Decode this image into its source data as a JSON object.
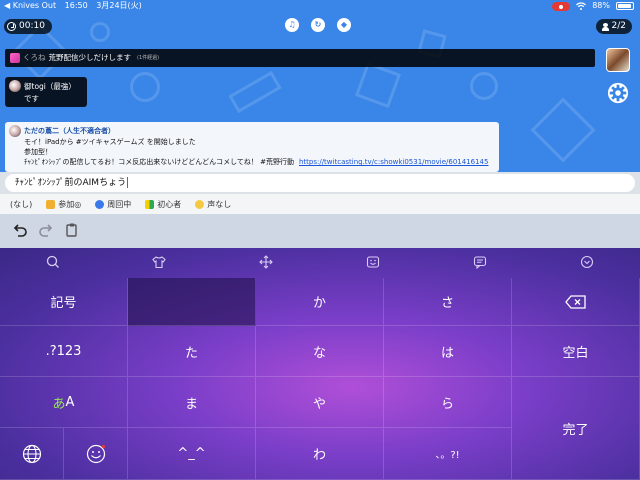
{
  "status_bar": {
    "back_app": "◀ Knives Out",
    "time": "16:50",
    "date": "3月24日(火)",
    "battery": "88%"
  },
  "stream": {
    "timer": "00:10",
    "viewers": "2/2",
    "top_icons": [
      "headset-icon",
      "refresh-icon",
      "drop-icon"
    ],
    "marquee": {
      "user": "くろね",
      "message": "荒野配信少しだけします",
      "suffix": "(1件経過)"
    },
    "comments": [
      {
        "name": "御togi（最強）",
        "body": "です"
      },
      {
        "name": "ただの蔦二（人生不適合者）",
        "lines": [
          "モイ！iPadから #ツイキャスゲームズ を開始しました",
          "参加型！",
          "ﾁｬﾝﾋﾟｵﾝｼｯﾌﾟの配信してるお！コメ反応出来ないけどどんどんコメしてね！ #荒野行動"
        ],
        "link": "https://twitcasting.tv/c:showki0531/movie/601416145"
      }
    ]
  },
  "input": {
    "value": "ﾁｬﾝﾋﾟｵﾝｼｯﾌﾟ前のAIMちょう"
  },
  "tags": [
    "(なし)",
    "参加◎",
    "周回中",
    "初心者",
    "声なし"
  ],
  "keyboard": {
    "keys": {
      "kigou": "記号",
      "blank": "",
      "ka": "か",
      "sa": "さ",
      "num": ".?123",
      "ta": "た",
      "na": "な",
      "ha": "は",
      "space": "空白",
      "mode_a": "あ",
      "mode_b": "A",
      "ma": "ま",
      "ya": "や",
      "ra": "ら",
      "done": "完了",
      "face": "^_^",
      "wa": "わ",
      "punct": "、。?!"
    }
  }
}
